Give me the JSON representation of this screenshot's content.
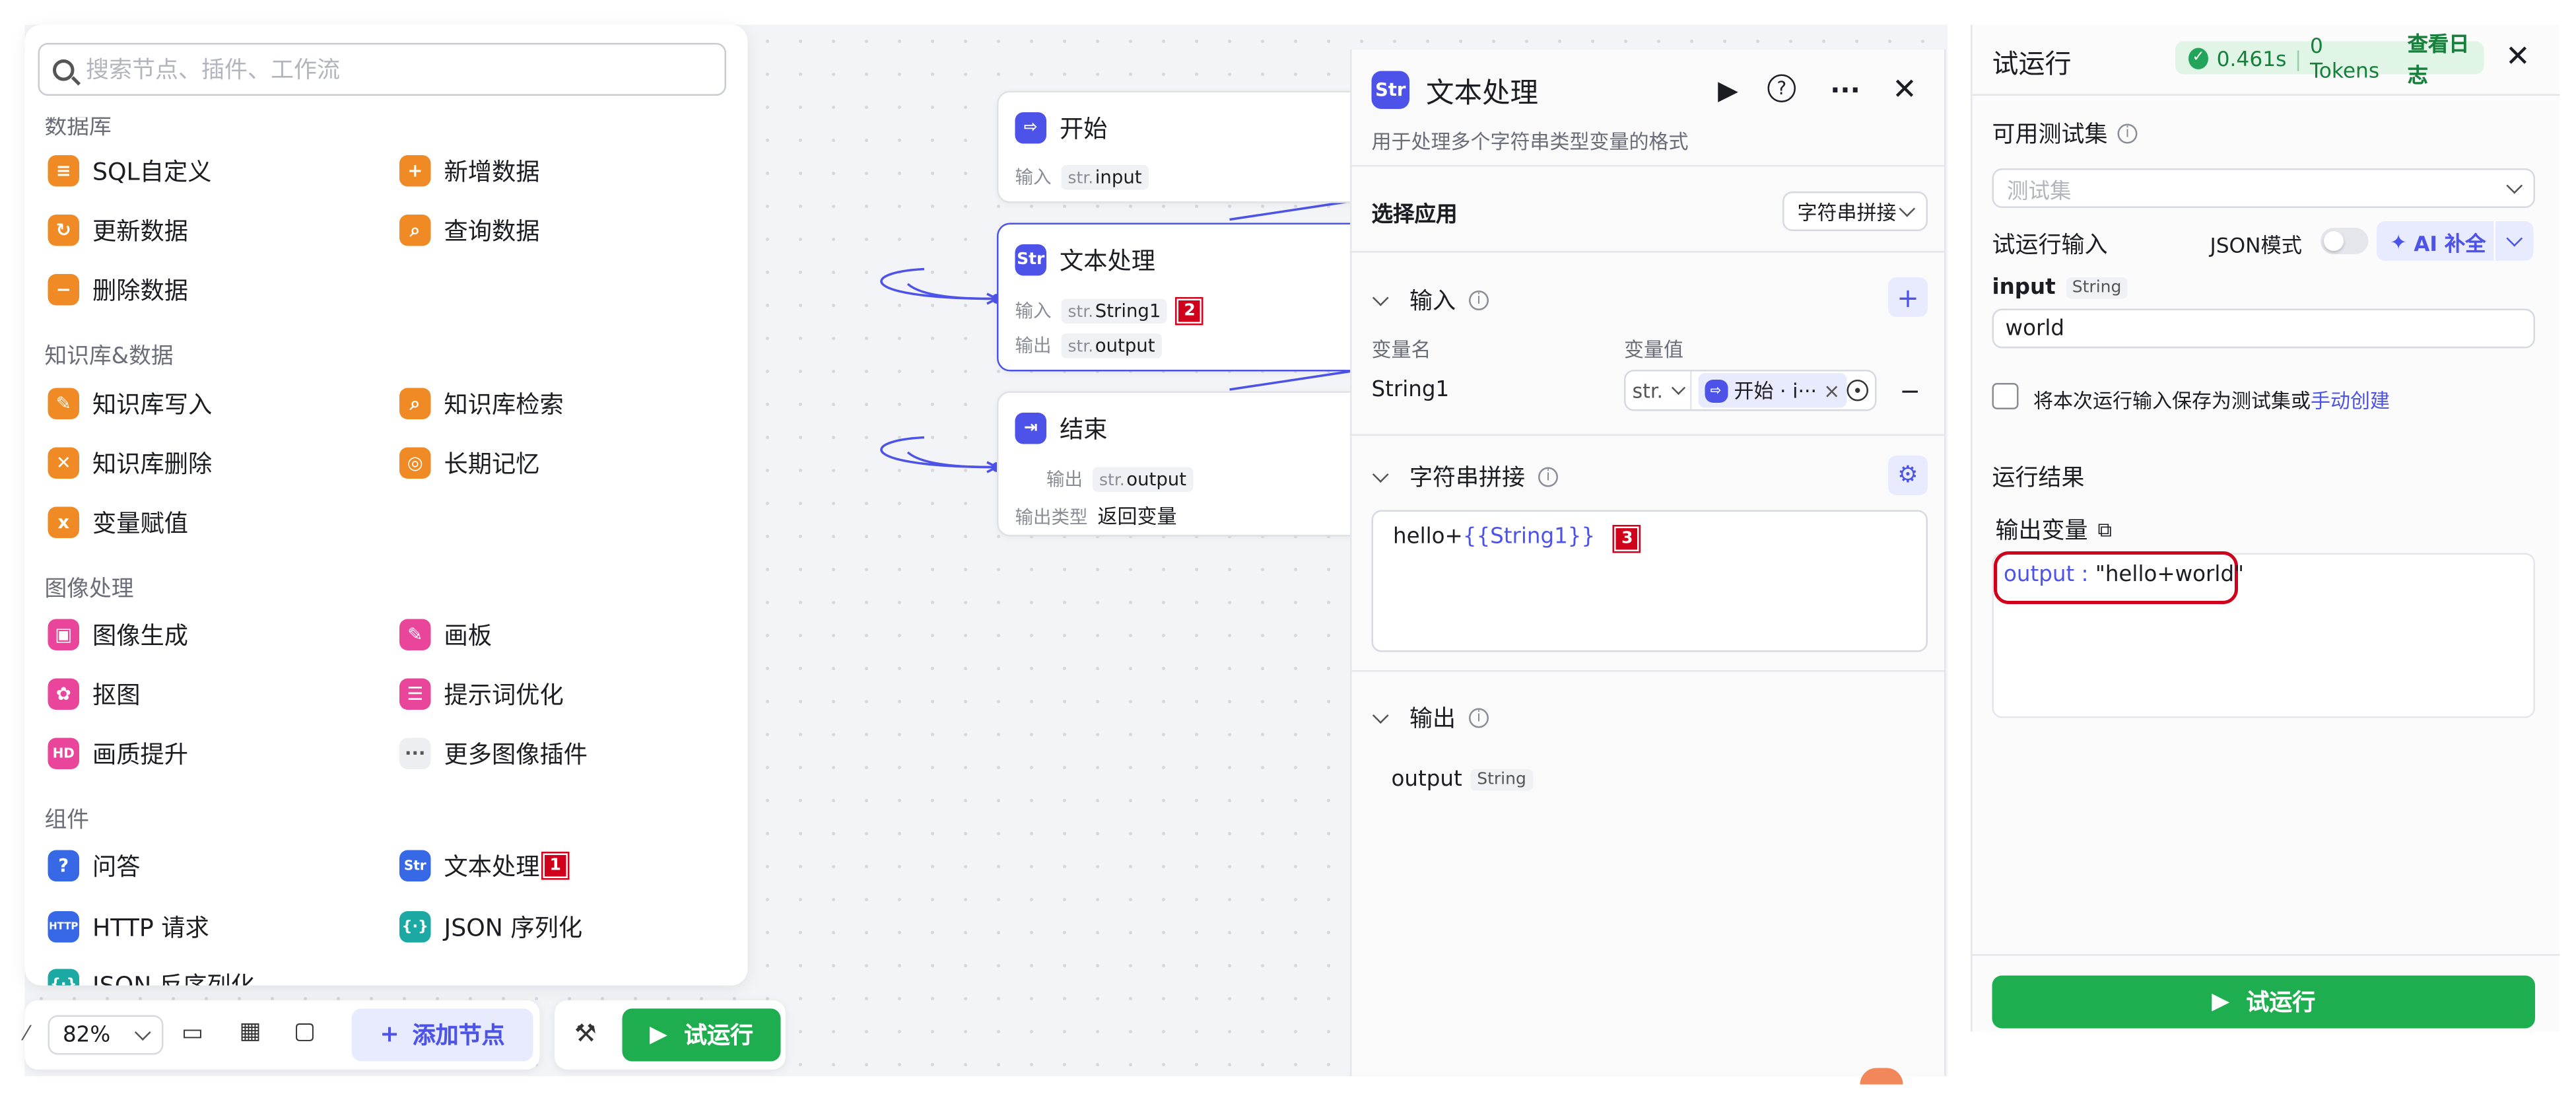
{
  "node_panel": {
    "search_placeholder": "搜索节点、插件、工作流",
    "sections": [
      {
        "title": "数据库",
        "items": [
          {
            "label": "SQL自定义",
            "icon": "database-icon"
          },
          {
            "label": "新增数据",
            "icon": "database-add-icon"
          },
          {
            "label": "更新数据",
            "icon": "database-update-icon"
          },
          {
            "label": "查询数据",
            "icon": "database-query-icon"
          },
          {
            "label": "删除数据",
            "icon": "database-delete-icon"
          }
        ]
      },
      {
        "title": "知识库&数据",
        "items": [
          {
            "label": "知识库写入",
            "icon": "knowledge-write-icon"
          },
          {
            "label": "知识库检索",
            "icon": "knowledge-search-icon"
          },
          {
            "label": "知识库删除",
            "icon": "knowledge-delete-icon"
          },
          {
            "label": "长期记忆",
            "icon": "memory-icon"
          },
          {
            "label": "变量赋值",
            "icon": "variable-assign-icon"
          }
        ]
      },
      {
        "title": "图像处理",
        "items": [
          {
            "label": "图像生成",
            "icon": "image-generate-icon"
          },
          {
            "label": "画板",
            "icon": "canvas-board-icon"
          },
          {
            "label": "抠图",
            "icon": "cutout-icon"
          },
          {
            "label": "提示词优化",
            "icon": "prompt-optimize-icon"
          },
          {
            "label": "画质提升",
            "icon": "hd-upscale-icon"
          },
          {
            "label": "更多图像插件",
            "icon": "more-icon"
          }
        ]
      },
      {
        "title": "组件",
        "items": [
          {
            "label": "问答",
            "icon": "question-icon"
          },
          {
            "label": "文本处理",
            "icon": "text-process-icon"
          },
          {
            "label": "HTTP 请求",
            "icon": "http-icon"
          },
          {
            "label": "JSON 序列化",
            "icon": "json-icon"
          },
          {
            "label": "JSON 反序列化",
            "icon": "json-parse-icon"
          }
        ]
      }
    ]
  },
  "markers": [
    "1",
    "2",
    "3"
  ],
  "flow": {
    "start_node": {
      "title": "开始",
      "input_label": "输入",
      "input_type": "str.",
      "input_name": "input"
    },
    "text_node": {
      "title": "文本处理",
      "input_label": "输入",
      "input_type": "str.",
      "input_name": "String1",
      "output_label": "输出",
      "output_type": "str.",
      "output_name": "output"
    },
    "end_node": {
      "title": "结束",
      "output_label": "输出",
      "output_type": "str.",
      "output_name": "output",
      "output_kind_label": "输出类型",
      "output_kind_value": "返回变量"
    }
  },
  "text_panel": {
    "title": "文本处理",
    "description": "用于处理多个字符串类型变量的格式",
    "select_app_label": "选择应用",
    "select_app_value": "字符串拼接",
    "input_section": "输入",
    "col_var_name": "变量名",
    "col_var_value": "变量值",
    "var_name": "String1",
    "var_type": "str.",
    "var_ref": "开始 · i···",
    "concat_section": "字符串拼接",
    "template_prefix": "hello+",
    "template_var": "{{String1}}",
    "output_section": "输出",
    "output_name": "output",
    "output_type": "String"
  },
  "run_panel": {
    "title": "试运行",
    "badge_time": "0.461s",
    "badge_tokens": "0 Tokens",
    "badge_log": "查看日志",
    "test_set_label": "可用测试集",
    "test_set_placeholder": "测试集",
    "run_input_label": "试运行输入",
    "json_mode_label": "JSON模式",
    "ai_fill_label": "AI 补全",
    "input_name": "input",
    "input_type": "String",
    "input_value": "world",
    "save_text": "将本次运行输入保存为测试集或",
    "save_link": "手动创建",
    "result_label": "运行结果",
    "output_var_label": "输出变量",
    "result_key": "output",
    "result_value": "\"hello+world\"",
    "run_button": "试运行"
  },
  "toolbar": {
    "zoom": "82%",
    "add_node": "添加节点",
    "run_button": "试运行"
  },
  "colors": {
    "accent": "#4d53e8",
    "green": "#1fae4f",
    "orange": "#f08a24",
    "pink": "#e9459b",
    "marker_red": "#d0021b"
  }
}
